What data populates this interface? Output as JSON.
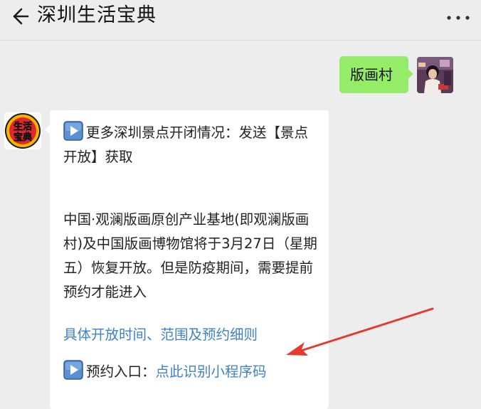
{
  "header": {
    "title": "深圳生活宝典",
    "back_icon": "back-arrow-icon",
    "more_icon": "more-dots-icon"
  },
  "messages": {
    "outgoing": {
      "text": "版画村",
      "bubble_color": "#95ec69"
    },
    "incoming": {
      "avatar_text_line1": "生活",
      "avatar_text_line2": "宝典",
      "line1_text": "更多深圳景点开闭情况：发送【景点开放】获取",
      "para_text": "中国·观澜版画原创产业基地(即观澜版画村)及中国版画博物馆将于3月27日（星期五）恢复开放。但是防疫期间，需要提前预约才能进入",
      "details_link": "具体开放时间、范围及预约细则",
      "reserve_label": "预约入口：",
      "reserve_link": "点此识别小程序码",
      "play_icon": "play-button-icon"
    }
  },
  "colors": {
    "background": "#ededed",
    "link": "#3f82c6",
    "annotation_arrow": "#e53a2f"
  }
}
